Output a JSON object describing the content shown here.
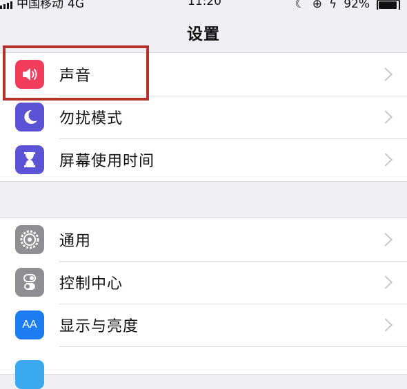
{
  "status_bar": {
    "carrier": "中国移动",
    "network": "4G",
    "time": "11:20",
    "battery": "92%"
  },
  "nav": {
    "title": "设置"
  },
  "groups": [
    {
      "items": [
        {
          "label": "声音",
          "icon": "speaker-icon",
          "color": "#f23c5b"
        },
        {
          "label": "勿扰模式",
          "icon": "moon-icon",
          "color": "#5b52d6"
        },
        {
          "label": "屏幕使用时间",
          "icon": "hourglass-icon",
          "color": "#5b52d6"
        }
      ]
    },
    {
      "items": [
        {
          "label": "通用",
          "icon": "gear-icon",
          "color": "#8e8e93"
        },
        {
          "label": "控制中心",
          "icon": "toggles-icon",
          "color": "#8e8e93"
        },
        {
          "label": "显示与亮度",
          "icon": "text-size-icon",
          "color": "#1e7cf2",
          "icon_text": "AA"
        }
      ]
    }
  ],
  "annotation_color": "#b5312b"
}
